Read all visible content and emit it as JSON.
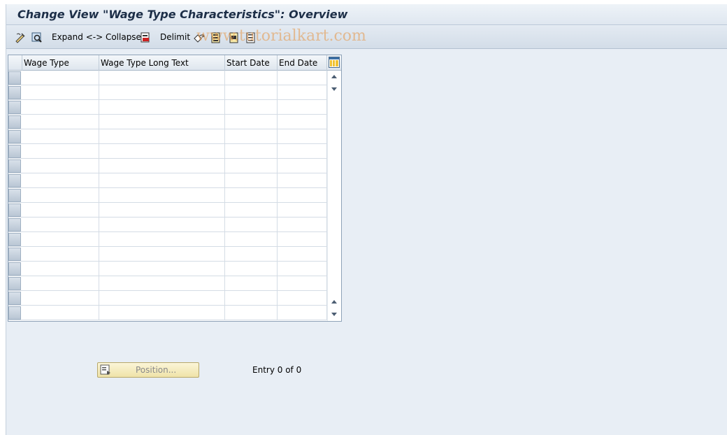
{
  "title": "Change View \"Wage Type Characteristics\": Overview",
  "toolbar": {
    "expand_collapse_label": "Expand <-> Collapse",
    "delimit_label": "Delimit",
    "icons": [
      "change-display-icon",
      "details-icon",
      "delimit-icon",
      "undo-change-icon",
      "select-all-icon",
      "select-block-icon",
      "deselect-all-icon"
    ]
  },
  "watermark": "www.tutorialkart.com",
  "table": {
    "columns": [
      "Wage Type",
      "Wage Type Long Text",
      "Start Date",
      "End Date"
    ],
    "row_count": 17
  },
  "footer": {
    "position_button_label": "Position...",
    "entry_text": "Entry 0 of 0"
  },
  "colors": {
    "window_bg": "#e8eef5",
    "title_text": "#1d2f48",
    "position_button_bg": "#fbf5d8"
  }
}
